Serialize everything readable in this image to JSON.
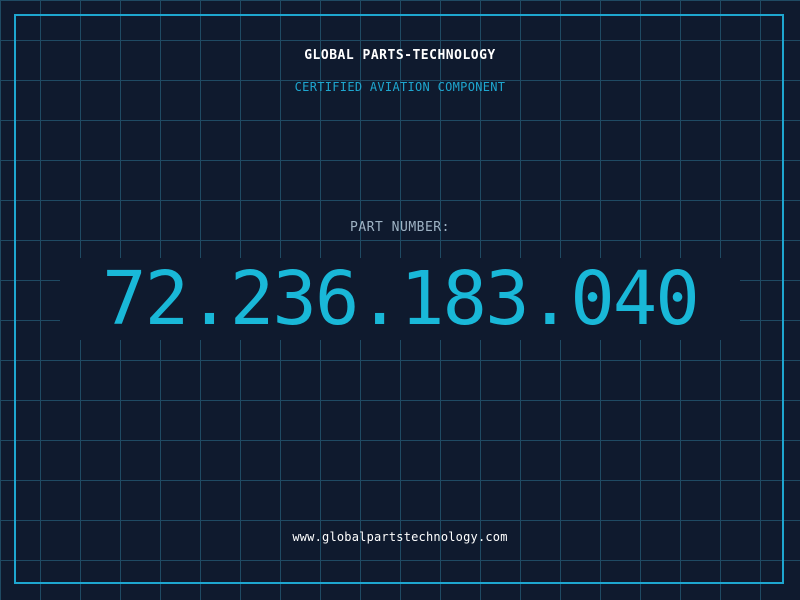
{
  "brand": {
    "name": "GLOBAL PARTS-TECHNOLOGY",
    "tagline": "CERTIFIED AVIATION COMPONENT"
  },
  "part": {
    "label": "PART NUMBER:",
    "number": "72.236.183.040"
  },
  "footer": {
    "website": "www.globalpartstechnology.com"
  },
  "colors": {
    "background": "#0f1a2e",
    "grid": "#1f4a63",
    "accent": "#1ea6cf",
    "part_number": "#19b8d8",
    "text": "#ffffff",
    "label": "#9fb3c4"
  }
}
